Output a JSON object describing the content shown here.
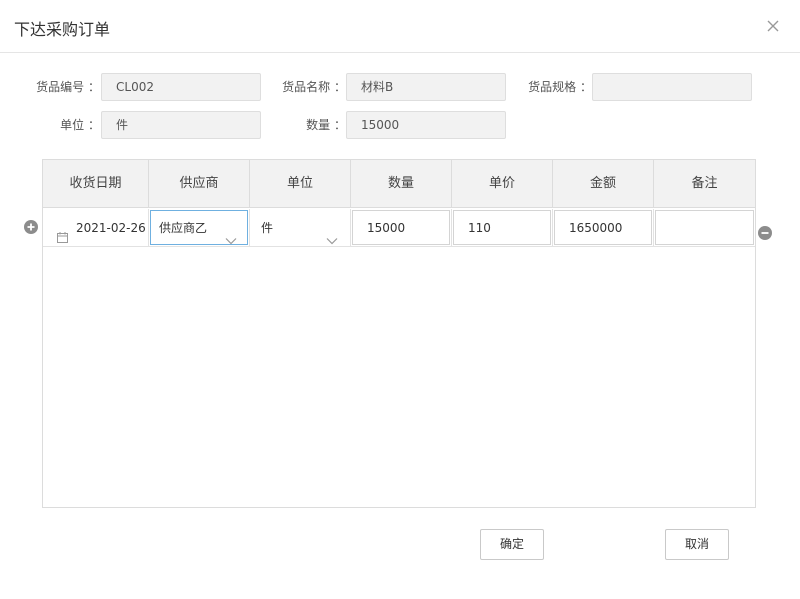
{
  "dialog": {
    "title": "下达采购订单"
  },
  "form": {
    "code_label": "货品编号 ：",
    "code_value": "CL002",
    "name_label": "货品名称 ：",
    "name_value": "材料B",
    "spec_label": "货品规格 ：",
    "spec_value": "",
    "unit_label": "单位 ：",
    "unit_value": "件",
    "qty_label": "数量 ：",
    "qty_value": "15000"
  },
  "table": {
    "columns": [
      "收货日期",
      "供应商",
      "单位",
      "数量",
      "单价",
      "金额",
      "备注"
    ],
    "rows": [
      {
        "date": "2021-02-26",
        "supplier": "供应商乙",
        "unit": "件",
        "qty": "15000",
        "price": "110",
        "amount": "1650000",
        "note": ""
      }
    ]
  },
  "buttons": {
    "confirm": "确定",
    "cancel": "取消"
  },
  "icons": {
    "close": "close-icon",
    "add": "plus-circle-icon",
    "remove": "minus-circle-icon",
    "calendar": "calendar-icon",
    "dropdown": "chevron-down-icon"
  }
}
